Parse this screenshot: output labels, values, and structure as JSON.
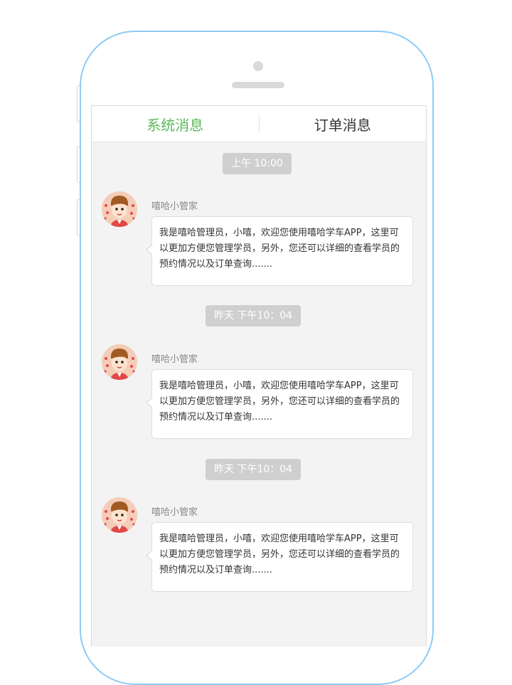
{
  "tabs": {
    "system": "系统消息",
    "order": "订单消息"
  },
  "messages": [
    {
      "time": "上午 10:00",
      "sender": "嘻哈小管家",
      "text": "我是嘻哈管理员，小嘻，欢迎您使用嘻哈学车APP，这里可以更加方便您管理学员，另外，您还可以详细的查看学员的预约情况以及订单查询......."
    },
    {
      "time": "昨天  下午10：04",
      "sender": "嘻哈小管家",
      "text": "我是嘻哈管理员，小嘻，欢迎您使用嘻哈学车APP，这里可以更加方便您管理学员，另外，您还可以详细的查看学员的预约情况以及订单查询......."
    },
    {
      "time": "昨天  下午10：04",
      "sender": "嘻哈小管家",
      "text": "我是嘻哈管理员，小嘻，欢迎您使用嘻哈学车APP，这里可以更加方便您管理学员，另外，您还可以详细的查看学员的预约情况以及订单查询......."
    }
  ],
  "colors": {
    "accent": "#5cb85c",
    "phone_frame": "#8ecbf3",
    "badge": "#cfcfcf"
  },
  "icons": {
    "avatar": "cartoon-boy-avatar-icon"
  }
}
